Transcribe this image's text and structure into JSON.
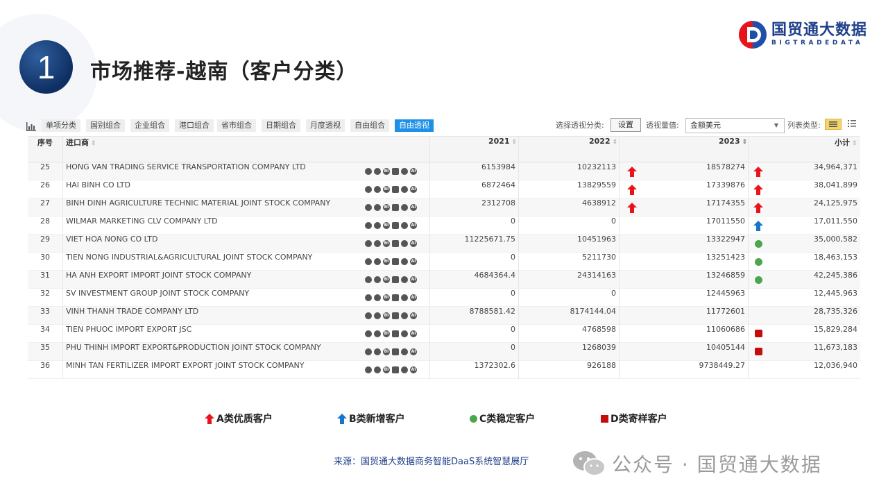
{
  "header": {
    "section_number": "1",
    "title": "市场推荐-越南（客户分类）",
    "logo_cn": "国贸通大数据",
    "logo_en": "BIGTRADEDATA"
  },
  "toolbar": {
    "tabs": [
      "单项分类",
      "国别组合",
      "企业组合",
      "港口组合",
      "省市组合",
      "日期组合",
      "月度透视",
      "自由组合",
      "自由透视"
    ],
    "active_tab": "自由透视",
    "pivot_label": "选择透视分类:",
    "set_button": "设置",
    "measure_label": "透视量值:",
    "measure_value": "金额美元",
    "list_type_label": "列表类型:"
  },
  "table": {
    "headers": {
      "idx": "序号",
      "name": "进口商",
      "y2021": "2021",
      "y2022": "2022",
      "y2023": "2023",
      "subtotal": "小计"
    },
    "rows": [
      {
        "idx": "25",
        "name": "HONG VAN TRADING SERVICE TRANSPORTATION COMPANY LTD",
        "y2021": "6153984",
        "y2022": "10232113",
        "ind1": "up-red",
        "y2023": "18578274",
        "ind2": "up-red",
        "subtotal": "34,964,371"
      },
      {
        "idx": "26",
        "name": "HAI BINH CO LTD",
        "y2021": "6872464",
        "y2022": "13829559",
        "ind1": "up-red",
        "y2023": "17339876",
        "ind2": "up-red",
        "subtotal": "38,041,899"
      },
      {
        "idx": "27",
        "name": "BINH DINH AGRICULTURE TECHNIC MATERIAL JOINT STOCK COMPANY",
        "y2021": "2312708",
        "y2022": "4638912",
        "ind1": "up-red",
        "y2023": "17174355",
        "ind2": "up-red",
        "subtotal": "24,125,975"
      },
      {
        "idx": "28",
        "name": "WILMAR MARKETING CLV COMPANY LTD",
        "y2021": "0",
        "y2022": "0",
        "ind1": "",
        "y2023": "17011550",
        "ind2": "up-blue",
        "subtotal": "17,011,550"
      },
      {
        "idx": "29",
        "name": "VIET HOA NONG CO LTD",
        "y2021": "11225671.75",
        "y2022": "10451963",
        "ind1": "",
        "y2023": "13322947",
        "ind2": "dot-green",
        "subtotal": "35,000,582"
      },
      {
        "idx": "30",
        "name": "TIEN NONG INDUSTRIAL&AGRICULTURAL JOINT STOCK COMPANY",
        "y2021": "0",
        "y2022": "5211730",
        "ind1": "",
        "y2023": "13251423",
        "ind2": "dot-green",
        "subtotal": "18,463,153"
      },
      {
        "idx": "31",
        "name": "HA ANH EXPORT IMPORT JOINT STOCK COMPANY",
        "y2021": "4684364.4",
        "y2022": "24314163",
        "ind1": "",
        "y2023": "13246859",
        "ind2": "dot-green",
        "subtotal": "42,245,386"
      },
      {
        "idx": "32",
        "name": "SV INVESTMENT GROUP JOINT STOCK COMPANY",
        "y2021": "0",
        "y2022": "0",
        "ind1": "",
        "y2023": "12445963",
        "ind2": "",
        "subtotal": "12,445,963"
      },
      {
        "idx": "33",
        "name": "VINH THANH TRADE COMPANY LTD",
        "y2021": "8788581.42",
        "y2022": "8174144.04",
        "ind1": "",
        "y2023": "11772601",
        "ind2": "",
        "subtotal": "28,735,326"
      },
      {
        "idx": "34",
        "name": "TIEN PHUOC IMPORT EXPORT JSC",
        "y2021": "0",
        "y2022": "4768598",
        "ind1": "",
        "y2023": "11060686",
        "ind2": "sq-red",
        "subtotal": "15,829,284"
      },
      {
        "idx": "35",
        "name": "PHU THINH IMPORT EXPORT&PRODUCTION JOINT STOCK COMPANY",
        "y2021": "0",
        "y2022": "1268039",
        "ind1": "",
        "y2023": "10405144",
        "ind2": "sq-red",
        "subtotal": "11,673,183"
      },
      {
        "idx": "36",
        "name": "MINH TAN FERTILIZER IMPORT EXPORT JOINT STOCK COMPANY",
        "y2021": "1372302.6",
        "y2022": "926188",
        "ind1": "",
        "y2023": "9738449.27",
        "ind2": "",
        "subtotal": "12,036,940"
      }
    ]
  },
  "legend": [
    {
      "mark": "up-red",
      "label": "A类优质客户"
    },
    {
      "mark": "up-blue",
      "label": "B类新增客户"
    },
    {
      "mark": "dot-green",
      "label": "C类稳定客户"
    },
    {
      "mark": "sq-red",
      "label": "D类寄样客户"
    }
  ],
  "footer": {
    "source": "来源：国贸通大数据商务智能DaaS系统智慧展厅",
    "watermark": "公众号 · 国贸通大数据"
  },
  "colors": {
    "accent": "#1e90e6",
    "up_red": "#e8141c",
    "up_blue": "#1576c9",
    "green": "#4ca64c",
    "square_red": "#c40c0c",
    "brand": "#1f3f8a"
  }
}
